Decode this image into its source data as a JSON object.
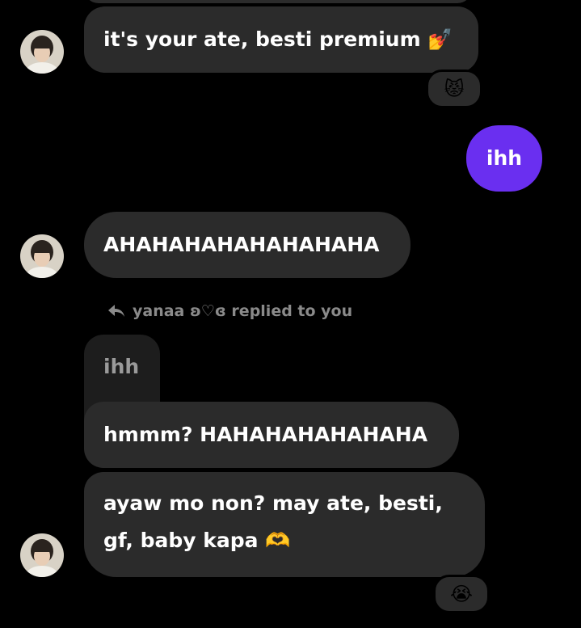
{
  "messages": {
    "m1": {
      "text": "it's your ate, besti premium",
      "emoji": "💅",
      "reaction": "😾"
    },
    "m2": {
      "text": "ihh"
    },
    "m3": {
      "text": "AHAHAHAHAHAHAHAHA"
    },
    "reply_header": "yanaa ʚ♡ɞ replied to you",
    "quoted": "ihh",
    "m4": {
      "text": "hmmm? HAHAHAHAHAHAHA"
    },
    "m5": {
      "line1": "ayaw mo non? may ate, besti,",
      "line2": "gf, baby kapa",
      "emoji": "🫶",
      "reaction": "😭"
    }
  },
  "colors": {
    "received_bubble": "#2b2b2b",
    "sent_bubble": "#6a2ff0",
    "quoted_bubble": "#1d1d1d",
    "background": "#000000"
  }
}
